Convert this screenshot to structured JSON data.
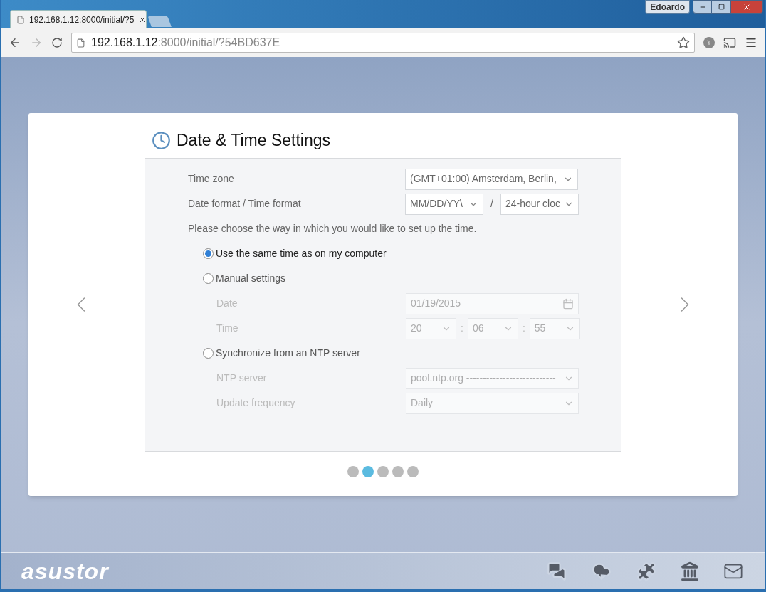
{
  "browser": {
    "user": "Edoardo",
    "tabs": [
      {
        "title": "192.168.1.12:8000/initial/?5",
        "selected": true
      },
      {
        "selected": false
      }
    ],
    "address": {
      "host": "192.168.1.12",
      "rest": ":8000/initial/?54BD637E"
    }
  },
  "page": {
    "title": "Date & Time Settings",
    "settings": [
      {
        "label": "Time zone",
        "kind": "select",
        "value": "(GMT+01:00) Amsterdam, Berlin,"
      },
      {
        "label": "Date format / Time format",
        "kind": "pair",
        "value": "MM/DD/YY\\",
        "separator": "/",
        "value2": "24-hour cloc"
      }
    ],
    "prompt": "Please choose the way in which you would like to set up the time.",
    "options": [
      {
        "label": "Use the same time as on my computer",
        "selected": true
      },
      {
        "label": "Manual settings",
        "selected": false,
        "fields": [
          {
            "label": "Date",
            "kind": "date",
            "value": "01/19/2015",
            "disabled": true
          },
          {
            "label": "Time",
            "kind": "time",
            "parts": [
              "20",
              "06",
              "55"
            ],
            "separator": ":",
            "disabled": true
          }
        ]
      },
      {
        "label": "Synchronize from an NTP server",
        "selected": false,
        "fields": [
          {
            "label": "NTP server",
            "kind": "select",
            "value": "pool.ntp.org ---------------------------",
            "disabled": true
          },
          {
            "label": "Update frequency",
            "kind": "select",
            "value": "Daily",
            "disabled": true
          }
        ]
      }
    ],
    "steps": [
      {
        "selected": false
      },
      {
        "selected": true
      },
      {
        "selected": false
      },
      {
        "selected": false
      },
      {
        "selected": false
      }
    ]
  },
  "footer": {
    "logo": "asustor"
  }
}
